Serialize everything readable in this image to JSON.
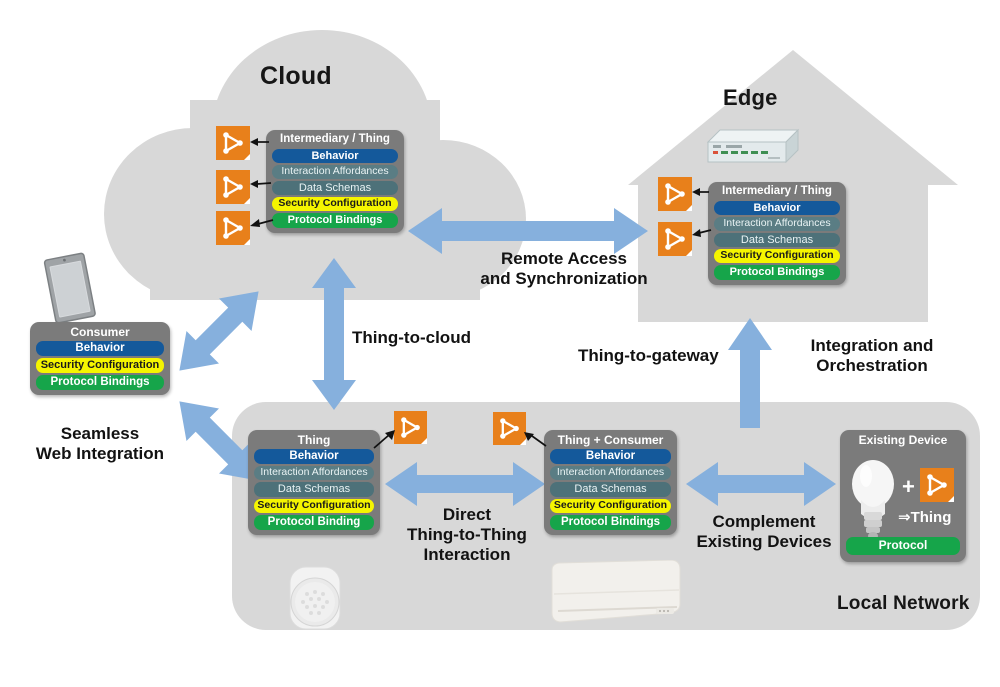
{
  "zones": {
    "cloud": {
      "title": "Cloud"
    },
    "edge": {
      "title": "Edge"
    },
    "local": {
      "title": "Local Network"
    }
  },
  "cards": {
    "cloud_td": {
      "title": "Intermediary / Thing",
      "rows": [
        {
          "label": "Behavior",
          "style": "behavior"
        },
        {
          "label": "Interaction Affordances",
          "style": "affordances"
        },
        {
          "label": "Data Schemas",
          "style": "schemas"
        },
        {
          "label": "Security Configuration",
          "style": "security"
        },
        {
          "label": "Protocol Bindings",
          "style": "protocol"
        }
      ]
    },
    "edge_td": {
      "title": "Intermediary / Thing",
      "rows": [
        {
          "label": "Behavior",
          "style": "behavior"
        },
        {
          "label": "Interaction Affordances",
          "style": "affordances"
        },
        {
          "label": "Data Schemas",
          "style": "schemas"
        },
        {
          "label": "Security Configuration",
          "style": "security"
        },
        {
          "label": "Protocol Bindings",
          "style": "protocol"
        }
      ]
    },
    "consumer": {
      "title": "Consumer",
      "rows": [
        {
          "label": "Behavior",
          "style": "behavior"
        },
        {
          "label": "Security Configuration",
          "style": "security"
        },
        {
          "label": "Protocol Bindings",
          "style": "protocol"
        }
      ]
    },
    "thing": {
      "title": "Thing",
      "rows": [
        {
          "label": "Behavior",
          "style": "behavior"
        },
        {
          "label": "Interaction Affordances",
          "style": "affordances"
        },
        {
          "label": "Data Schemas",
          "style": "schemas"
        },
        {
          "label": "Security Configuration",
          "style": "security"
        },
        {
          "label": "Protocol Binding",
          "style": "protocol"
        }
      ]
    },
    "thing_consumer": {
      "title": "Thing + Consumer",
      "rows": [
        {
          "label": "Behavior",
          "style": "behavior"
        },
        {
          "label": "Interaction Affordances",
          "style": "affordances"
        },
        {
          "label": "Data Schemas",
          "style": "schemas"
        },
        {
          "label": "Security Configuration",
          "style": "security"
        },
        {
          "label": "Protocol Bindings",
          "style": "protocol"
        }
      ]
    },
    "existing_device": {
      "title": "Existing Device",
      "plus": "+",
      "becomes": "⇒Thing",
      "protocol": "Protocol"
    }
  },
  "labels": {
    "remote_access": "Remote Access\nand Synchronization",
    "thing_to_cloud": "Thing-to-cloud",
    "thing_to_gateway": "Thing-to-gateway",
    "integration": "Integration and\nOrchestration",
    "seamless": "Seamless\nWeb Integration",
    "direct": "Direct\nThing-to-Thing\nInteraction",
    "complement": "Complement\nExisting Devices"
  },
  "icons": {
    "wot_logo": "wot-logo-icon",
    "laptop": "laptop-icon",
    "router": "router-icon",
    "motion_sensor": "motion-sensor-icon",
    "air_conditioner": "air-conditioner-icon",
    "light_bulb": "light-bulb-icon"
  },
  "colors": {
    "zone_gray": "#d8d8d8",
    "card_gray": "#7b7b7b",
    "behavior_blue": "#14599b",
    "affordances_teal": "#5a7d84",
    "schemas_teal": "#4d7179",
    "security_yellow": "#f5f500",
    "protocol_green": "#16a54a",
    "wot_orange": "#e8801b",
    "arrow_blue": "#86b0dd",
    "text_dark": "#121212"
  }
}
